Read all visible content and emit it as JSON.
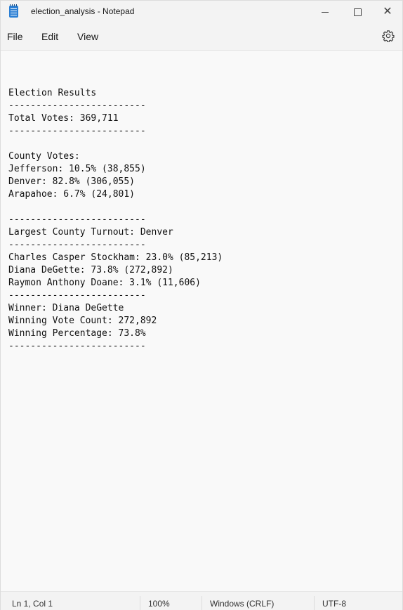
{
  "window": {
    "title": "election_analysis - Notepad",
    "icon": "notepad-icon",
    "controls": {
      "minimize": "minimize-icon",
      "maximize": "maximize-icon",
      "close": "✕"
    }
  },
  "menu": {
    "file": "File",
    "edit": "Edit",
    "view": "View",
    "settings_icon": "gear-icon"
  },
  "document": {
    "lines": [
      "",
      "Election Results",
      "-------------------------",
      "Total Votes: 369,711",
      "-------------------------",
      "",
      "County Votes:",
      "Jefferson: 10.5% (38,855)",
      "Denver: 82.8% (306,055)",
      "Arapahoe: 6.7% (24,801)",
      "",
      "-------------------------",
      "Largest County Turnout: Denver",
      "-------------------------",
      "Charles Casper Stockham: 23.0% (85,213)",
      "Diana DeGette: 73.8% (272,892)",
      "Raymon Anthony Doane: 3.1% (11,606)",
      "-------------------------",
      "Winner: Diana DeGette",
      "Winning Vote Count: 272,892",
      "Winning Percentage: 73.8%",
      "-------------------------"
    ]
  },
  "status": {
    "position": "Ln 1, Col 1",
    "zoom": "100%",
    "line_ending": "Windows (CRLF)",
    "encoding": "UTF-8"
  }
}
